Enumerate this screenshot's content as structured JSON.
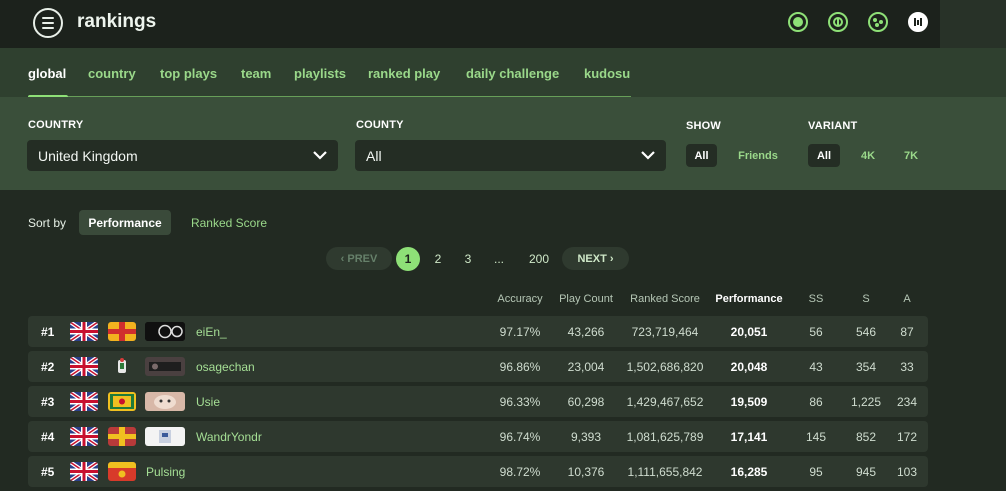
{
  "header": {
    "title": "rankings",
    "logo_icon": "rankings-logo-icon",
    "icons": [
      "live-icon",
      "mode-taiko-icon",
      "mode-catch-icon",
      "mode-mania-icon"
    ],
    "accent": "#8ee077"
  },
  "tabs": [
    {
      "label": "global",
      "active": true
    },
    {
      "label": "country",
      "active": false
    },
    {
      "label": "top plays",
      "active": false
    },
    {
      "label": "team",
      "active": false
    },
    {
      "label": "playlists",
      "active": false
    },
    {
      "label": "ranked play",
      "active": false
    },
    {
      "label": "daily challenge",
      "active": false
    },
    {
      "label": "kudosu",
      "active": false
    }
  ],
  "filters": {
    "country_label": "COUNTRY",
    "country_value": "United Kingdom",
    "county_label": "COUNTY",
    "county_value": "All",
    "show_label": "SHOW",
    "show_options": [
      "All",
      "Friends"
    ],
    "show_selected": "All",
    "variant_label": "VARIANT",
    "variant_options": [
      "All",
      "4K",
      "7K"
    ],
    "variant_selected": "All"
  },
  "sort": {
    "label": "Sort by",
    "options": [
      "Performance",
      "Ranked Score"
    ],
    "selected": "Performance"
  },
  "pagination": {
    "prev": "‹ PREV",
    "next": "NEXT ›",
    "pages": [
      "1",
      "2",
      "3",
      "...",
      "200"
    ],
    "current": "1"
  },
  "table": {
    "columns": [
      "Accuracy",
      "Play Count",
      "Ranked Score",
      "Performance",
      "SS",
      "S",
      "A"
    ],
    "rows": [
      {
        "rank": "#1",
        "name": "eiEn_",
        "accuracy": "97.17%",
        "play_count": "43,266",
        "ranked_score": "723,719,464",
        "performance": "20,051",
        "ss": "56",
        "s": "546",
        "a": "87"
      },
      {
        "rank": "#2",
        "name": "osagechan",
        "accuracy": "96.86%",
        "play_count": "23,004",
        "ranked_score": "1,502,686,820",
        "performance": "20,048",
        "ss": "43",
        "s": "354",
        "a": "33"
      },
      {
        "rank": "#3",
        "name": "Usie",
        "accuracy": "96.33%",
        "play_count": "60,298",
        "ranked_score": "1,429,467,652",
        "performance": "19,509",
        "ss": "86",
        "s": "1,225",
        "a": "234"
      },
      {
        "rank": "#4",
        "name": "WandrYondr",
        "accuracy": "96.74%",
        "play_count": "9,393",
        "ranked_score": "1,081,625,789",
        "performance": "17,141",
        "ss": "145",
        "s": "852",
        "a": "172"
      },
      {
        "rank": "#5",
        "name": "Pulsing",
        "accuracy": "98.72%",
        "play_count": "10,376",
        "ranked_score": "1,111,655,842",
        "performance": "16,285",
        "ss": "95",
        "s": "945",
        "a": "103"
      }
    ]
  }
}
